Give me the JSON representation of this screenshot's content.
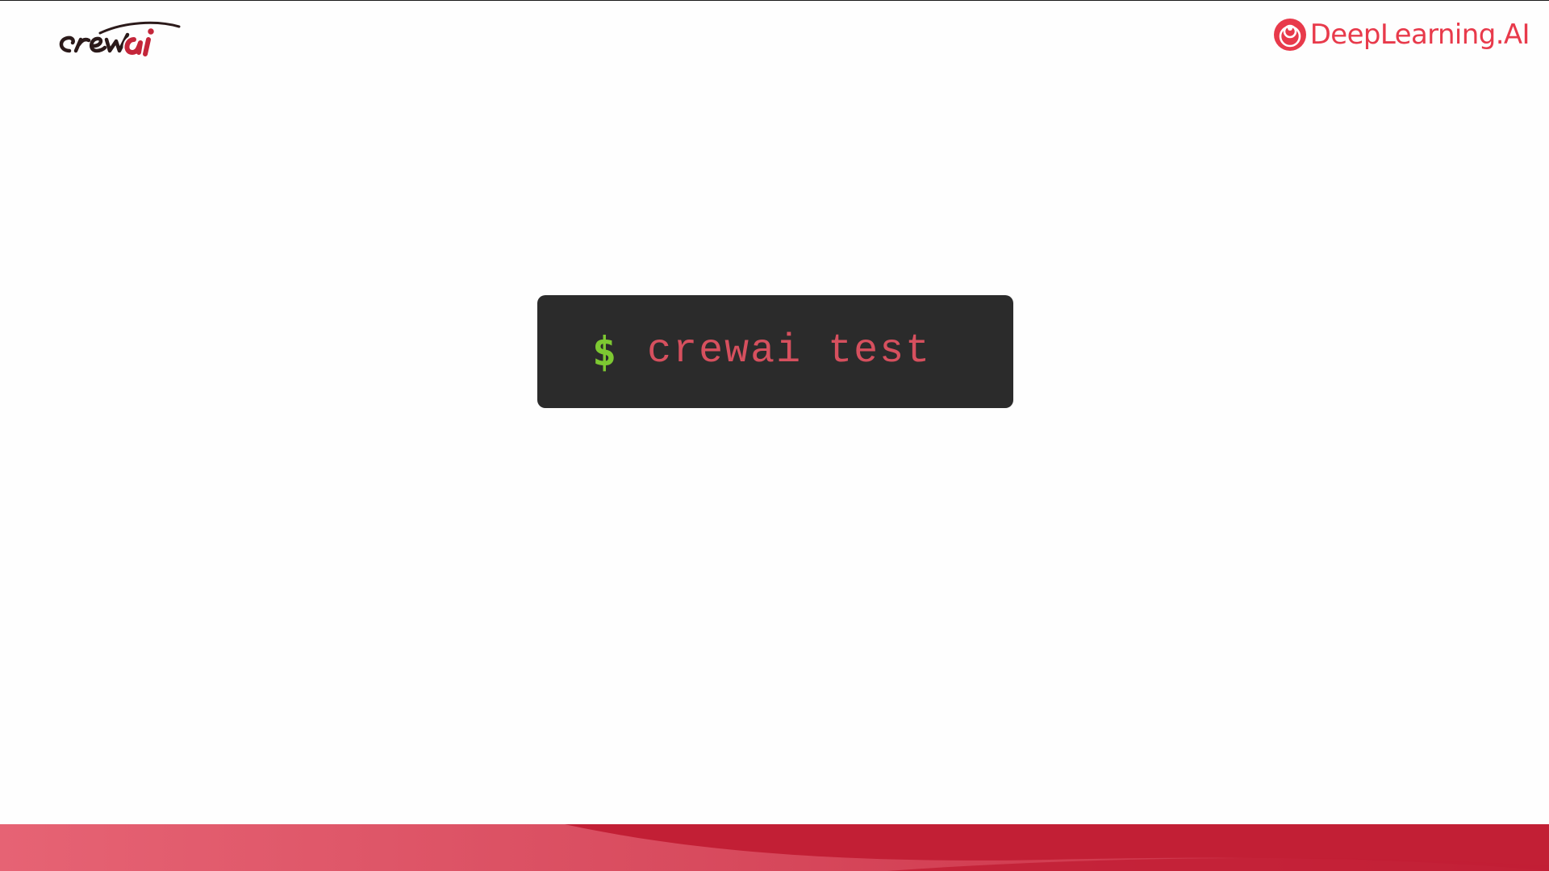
{
  "brand_left": {
    "logo_text": "crewai",
    "colors": {
      "ink": "#2b1a1a",
      "accent": "#c4263a",
      "outline": "#ffffff"
    }
  },
  "brand_right": {
    "name": "DeepLearning.AI",
    "icon": "deeplearning-ai-mark-icon",
    "color": "#e83a4b"
  },
  "terminal": {
    "prompt": "$",
    "command": "crewai test",
    "colors": {
      "background": "#2b2b2b",
      "prompt": "#7dc832",
      "command": "#d6505e"
    }
  },
  "footer": {
    "colors": {
      "band_light": "#e05566",
      "band_dark": "#c21f35"
    }
  }
}
